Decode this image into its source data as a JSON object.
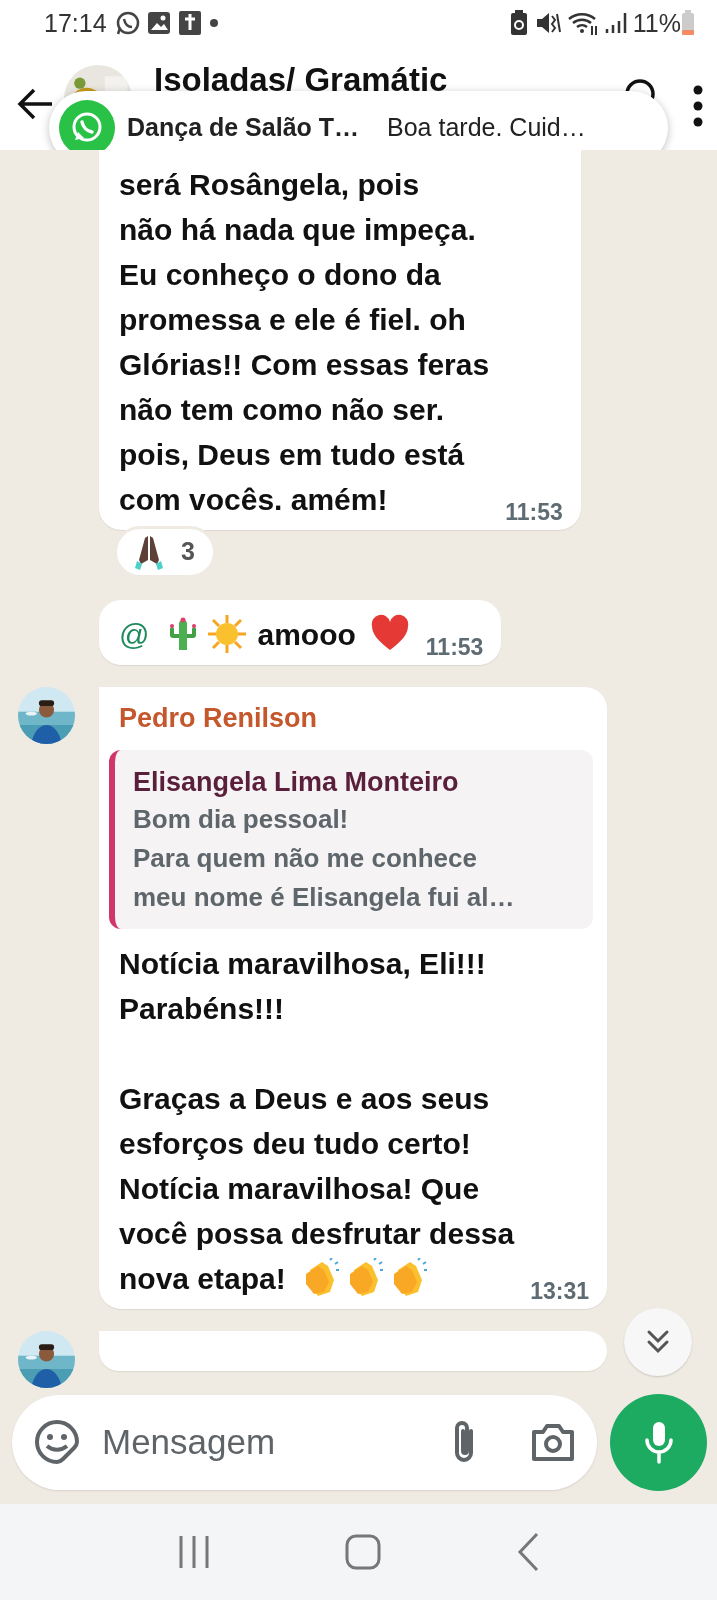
{
  "status_bar": {
    "time": "17:14",
    "battery": "11%"
  },
  "header": {
    "title": "Isoladas/ Gramátic"
  },
  "notification": {
    "title": "Dança de Salão T…",
    "text": "Boa tarde. Cuid…"
  },
  "messages": [
    {
      "kind": "plain",
      "has_avatar": false,
      "lines": [
        [
          {
            "kind": "text",
            "text": "será Rosângela, pois\nnão há nada que impeça.\nEu conheço o dono da\npromessa e ele é fiel. oh\nGlórias!! Com essas feras\nnão tem como não ser.\npois, Deus em tudo está\ncom vocês. amém!"
          }
        ]
      ],
      "time": "11:53",
      "reactions": [
        {
          "kind": "pray",
          "count": "3"
        }
      ]
    },
    {
      "kind": "plain",
      "has_avatar": false,
      "tail": false,
      "lines": [
        [
          {
            "kind": "mention",
            "text": "@"
          },
          {
            "kind": "cactus"
          },
          {
            "kind": "sun"
          },
          {
            "kind": "text",
            "text": "amooo"
          },
          {
            "kind": "heart"
          }
        ]
      ],
      "time": "11:53"
    },
    {
      "kind": "reply",
      "has_avatar": true,
      "tail": true,
      "sender": "Pedro Renilson",
      "quote": {
        "author": "Elisangela Lima Monteiro",
        "text": "Bom dia pessoal!\nPara quem não me conhece\nmeu nome é Elisangela fui al…"
      },
      "lines": [
        [
          {
            "kind": "text",
            "text": "Notícia maravilhosa, Eli!!!\nParabéns!!!\n\nGraças a Deus e aos seus\nesforços deu tudo certo!\nNotícia maravilhosa! Que\nvocê possa desfrutar dessa"
          }
        ],
        [
          {
            "kind": "text",
            "text": "nova etapa!"
          },
          {
            "kind": "clap"
          },
          {
            "kind": "clap"
          },
          {
            "kind": "clap"
          }
        ]
      ],
      "time": "13:31"
    },
    {
      "kind": "partial",
      "has_avatar": true
    }
  ],
  "composer": {
    "placeholder": "Mensagem"
  }
}
